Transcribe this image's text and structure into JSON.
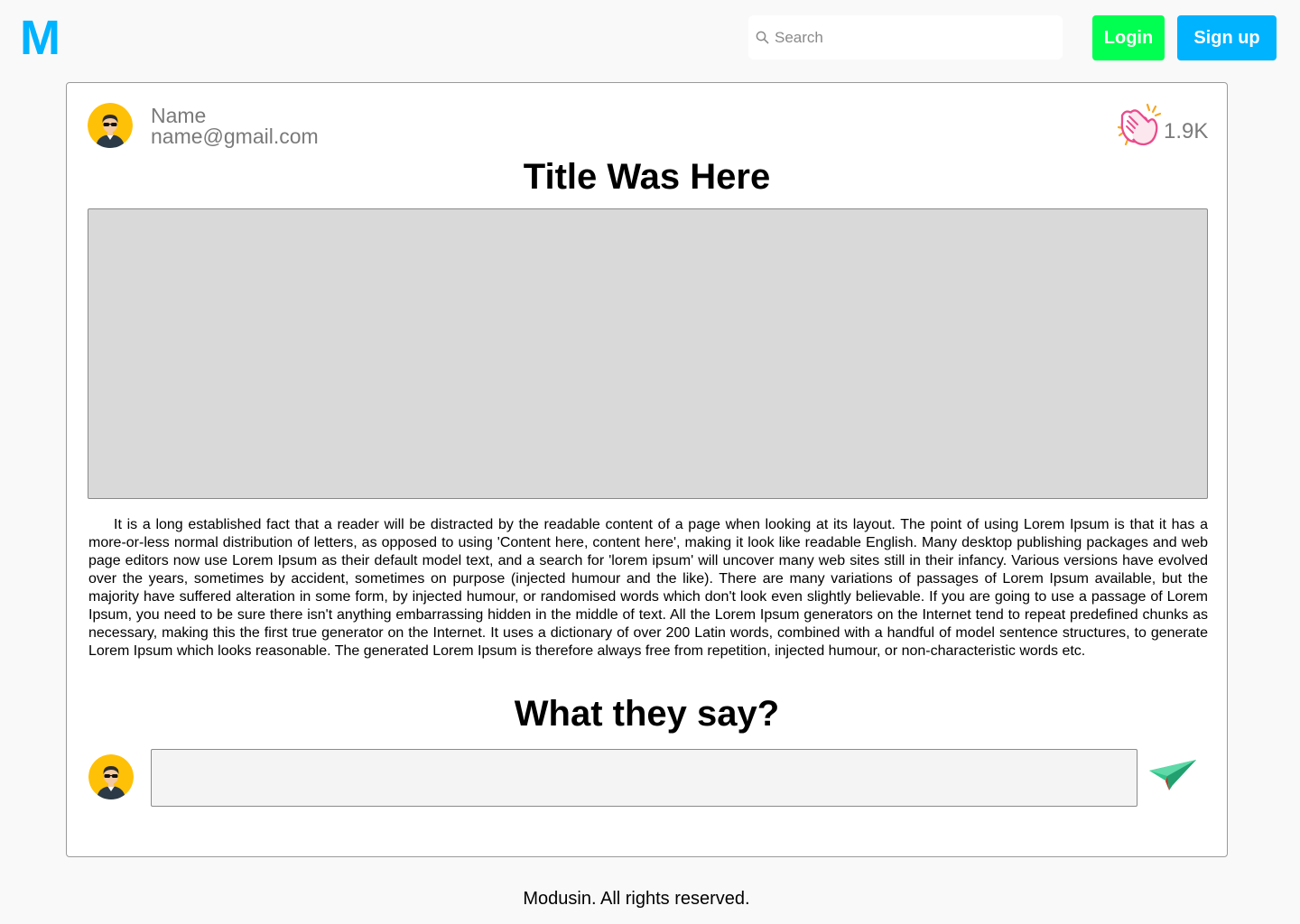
{
  "header": {
    "logo": "M",
    "search": {
      "placeholder": "Search",
      "value": ""
    },
    "login_label": "Login",
    "signup_label": "Sign up"
  },
  "colors": {
    "brand": "#00b3ff",
    "login": "#00ff50",
    "signup": "#00b3ff",
    "avatar_bg": "#ffc107",
    "clap": "#e84c8b",
    "send": "#2ec58a"
  },
  "post": {
    "author": {
      "name": "Name",
      "email": "name@gmail.com",
      "avatar_icon": "user-sunglasses-avatar"
    },
    "claps": {
      "icon": "clapping-hands-icon",
      "count": "1.9K"
    },
    "title": "Title Was Here",
    "body": "It is a long established fact that a reader will be distracted by the readable content of a page when looking at its layout. The point of using Lorem Ipsum is that it has a more-or-less normal distribution of letters, as opposed to using 'Content here, content here', making it look like readable English. Many desktop publishing packages and web page editors now use Lorem Ipsum as their default model text, and a search for 'lorem ipsum' will uncover many web sites still in their infancy. Various versions have evolved over the years, sometimes by accident, sometimes on purpose (injected humour and the like). There are many variations of passages of Lorem Ipsum available, but the majority have suffered alteration in some form, by injected humour, or randomised words which don't look even slightly believable. If you are going to use a passage of Lorem Ipsum, you need to be sure there isn't anything embarrassing hidden in the middle of text. All the Lorem Ipsum generators on the Internet tend to repeat predefined chunks as necessary, making this the first true generator on the Internet. It uses a dictionary of over 200 Latin words, combined with a handful of model sentence structures, to generate Lorem Ipsum which looks reasonable. The generated Lorem Ipsum is therefore always free from repetition, injected humour, or non-characteristic words etc."
  },
  "comments": {
    "heading": "What they say?",
    "input_value": "",
    "send_icon": "paper-plane-icon"
  },
  "footer": {
    "text": "Modusin. All rights reserved."
  }
}
